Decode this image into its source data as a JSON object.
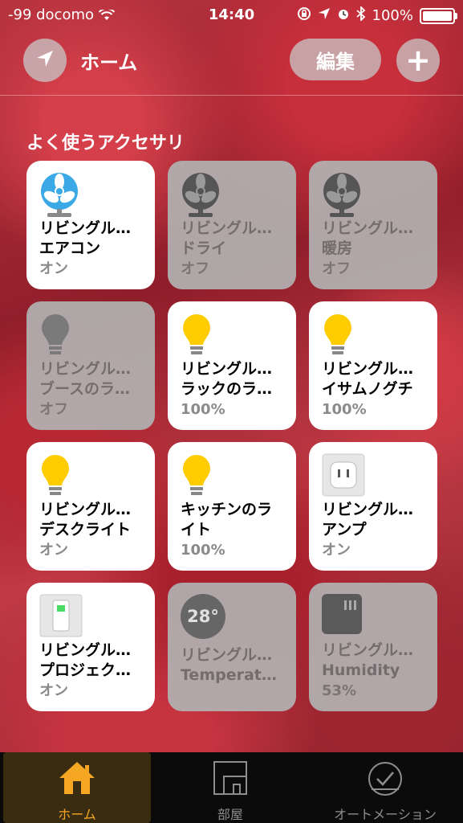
{
  "status": {
    "carrier": "-99 docomo",
    "time": "14:40",
    "battery": "100%"
  },
  "header": {
    "title": "ホーム",
    "edit_label": "編集",
    "add_label": "+"
  },
  "section_title": "よく使うアクセサリ",
  "tiles": [
    {
      "line1": "リビングル…",
      "line2": "エアコン",
      "state": "オン",
      "icon": "fan-icon",
      "on": true
    },
    {
      "line1": "リビングル…",
      "line2": "ドライ",
      "state": "オフ",
      "icon": "fan-icon",
      "on": false
    },
    {
      "line1": "リビングル…",
      "line2": "暖房",
      "state": "オフ",
      "icon": "fan-icon",
      "on": false
    },
    {
      "line1": "リビングル…",
      "line2": "ブースのラ…",
      "state": "オフ",
      "icon": "bulb-icon",
      "on": false
    },
    {
      "line1": "リビングル…",
      "line2": "ラックのラ…",
      "state": "100%",
      "icon": "bulb-icon",
      "on": true
    },
    {
      "line1": "リビングル…",
      "line2": "イサムノグチ",
      "state": "100%",
      "icon": "bulb-icon",
      "on": true
    },
    {
      "line1": "リビングル…",
      "line2": "デスクライト",
      "state": "オン",
      "icon": "bulb-icon",
      "on": true
    },
    {
      "line1": "キッチンのラ",
      "line2": "イト",
      "state": "100%",
      "icon": "bulb-icon",
      "on": true
    },
    {
      "line1": "リビングル…",
      "line2": "アンプ",
      "state": "オン",
      "icon": "outlet-icon",
      "on": true
    },
    {
      "line1": "リビングル…",
      "line2": "プロジェク…",
      "state": "オン",
      "icon": "switch-icon",
      "on": true
    },
    {
      "line1": "リビングル…",
      "line2": "Temperat…",
      "state": "",
      "icon": "thermometer-icon",
      "badge": "28°",
      "on": false
    },
    {
      "line1": "リビングル…",
      "line2": "Humidity",
      "state": "53%",
      "icon": "humidity-icon",
      "on": false
    }
  ],
  "tabs": [
    {
      "label": "ホーム",
      "icon": "house-icon",
      "active": true
    },
    {
      "label": "部屋",
      "icon": "rooms-icon",
      "active": false
    },
    {
      "label": "オートメーション",
      "icon": "clock-icon",
      "active": false
    }
  ],
  "colors": {
    "accent": "#f5a623",
    "bulb_on": "#ffcc00",
    "fan_on": "#3aa9e6",
    "tile_off": "#b2b2b2"
  }
}
